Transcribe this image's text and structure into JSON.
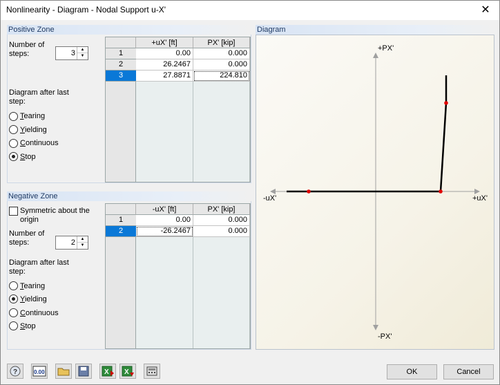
{
  "window": {
    "title": "Nonlinearity - Diagram - Nodal Support u-X'",
    "close_glyph": "✕"
  },
  "positive_zone": {
    "header": "Positive Zone",
    "steps_label_1": "Number of",
    "steps_label_2": "steps:",
    "steps_value": "3",
    "after_last_label_1": "Diagram after last",
    "after_last_label_2": "step:",
    "options": [
      {
        "accel": "T",
        "rest": "earing",
        "checked": false
      },
      {
        "accel": "Y",
        "rest": "ielding",
        "checked": false
      },
      {
        "accel": "C",
        "rest": "ontinuous",
        "checked": false
      },
      {
        "accel": "S",
        "rest": "top",
        "checked": true
      }
    ],
    "table": {
      "col_u": "+uX' [ft]",
      "col_p": "PX' [kip]",
      "rows": [
        {
          "idx": "1",
          "u": "0.00",
          "p": "0.000"
        },
        {
          "idx": "2",
          "u": "26.2467",
          "p": "0.000"
        },
        {
          "idx": "3",
          "u": "27.8871",
          "p": "224.810"
        }
      ]
    }
  },
  "negative_zone": {
    "header": "Negative Zone",
    "symmetric_label_1": "Symmetric about the",
    "symmetric_label_2": "origin",
    "steps_label_1": "Number of",
    "steps_label_2": "steps:",
    "steps_value": "2",
    "after_last_label_1": "Diagram after last",
    "after_last_label_2": "step:",
    "options": [
      {
        "accel": "T",
        "rest": "earing",
        "checked": false
      },
      {
        "accel": "Y",
        "rest": "ielding",
        "checked": true
      },
      {
        "accel": "C",
        "rest": "ontinuous",
        "checked": false
      },
      {
        "accel": "S",
        "rest": "top",
        "checked": false
      }
    ],
    "table": {
      "col_u": "-uX' [ft]",
      "col_p": "PX' [kip]",
      "rows": [
        {
          "idx": "1",
          "u": "0.00",
          "p": "0.000"
        },
        {
          "idx": "2",
          "u": "-26.2467",
          "p": "0.000"
        }
      ]
    }
  },
  "diagram": {
    "header": "Diagram",
    "axis_pos_p": "+PX'",
    "axis_neg_p": "-PX'",
    "axis_pos_u": "+uX'",
    "axis_neg_u": "-uX'",
    "curve_color": "#000000",
    "point_color": "#e00000",
    "axis_color": "#a0a0a0"
  },
  "toolbar": {
    "icons": [
      "help-icon",
      "decimal-places-icon",
      "open-folder-icon",
      "save-icon",
      "import-excel-icon",
      "export-excel-icon",
      "calculator-icon"
    ],
    "units_text": "0.00"
  },
  "buttons": {
    "ok": "OK",
    "cancel": "Cancel"
  }
}
